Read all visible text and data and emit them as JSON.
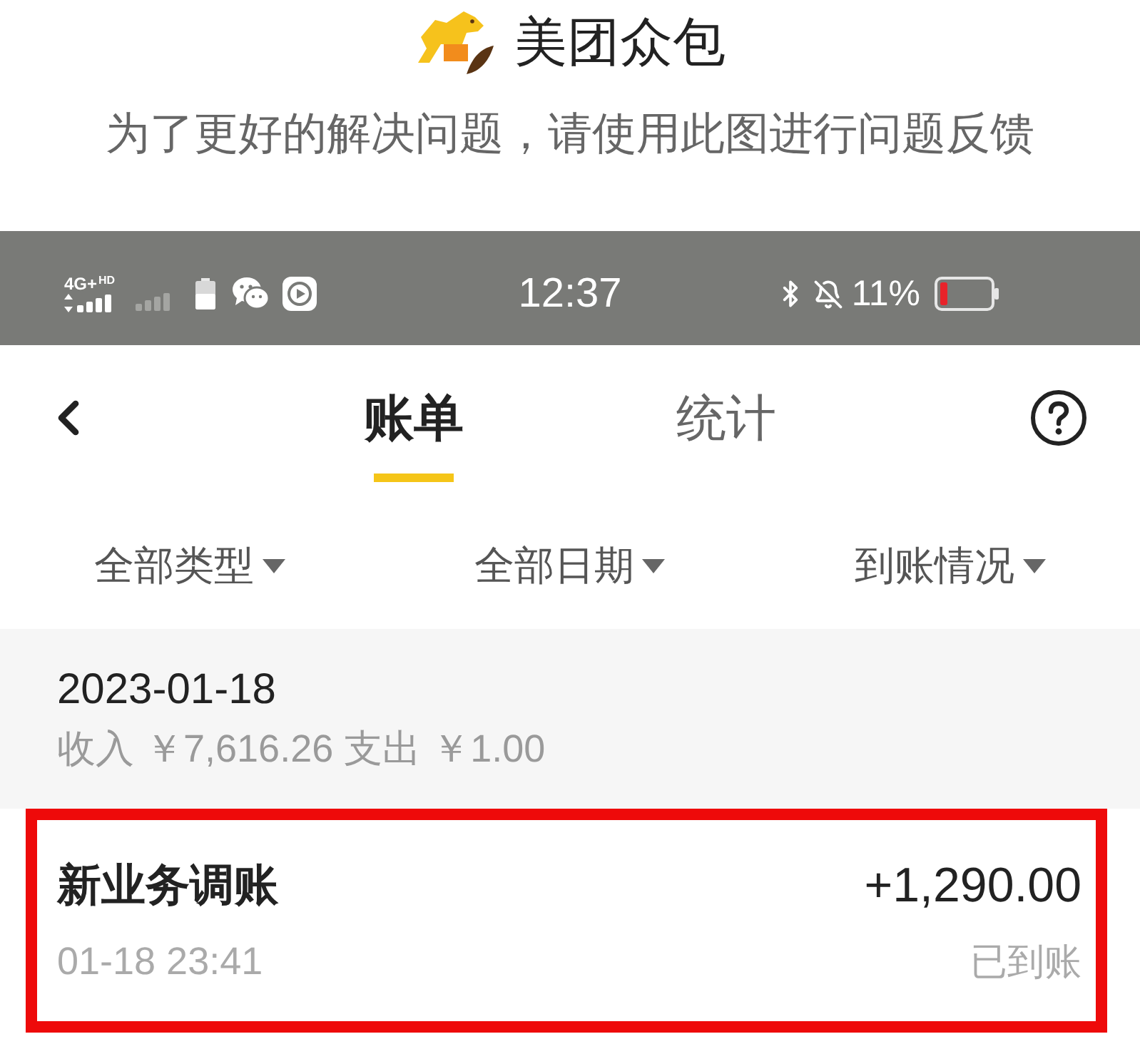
{
  "app_header": {
    "title": "美团众包",
    "subtitle": "为了更好的解决问题，请使用此图进行问题反馈"
  },
  "status_bar": {
    "network": "4G+",
    "network_badge": "HD",
    "time": "12:37",
    "battery_percent": "11%"
  },
  "nav": {
    "tabs": [
      {
        "label": "账单",
        "selected": true
      },
      {
        "label": "统计",
        "selected": false
      }
    ]
  },
  "filters": [
    {
      "label": "全部类型"
    },
    {
      "label": "全部日期"
    },
    {
      "label": "到账情况"
    }
  ],
  "day_group": {
    "date": "2023-01-18",
    "summary": "收入 ￥7,616.26 支出 ￥1.00"
  },
  "transactions": [
    {
      "title": "新业务调账",
      "amount": "+1,290.00",
      "time": "01-18 23:41",
      "status": "已到账",
      "highlighted": true
    }
  ]
}
